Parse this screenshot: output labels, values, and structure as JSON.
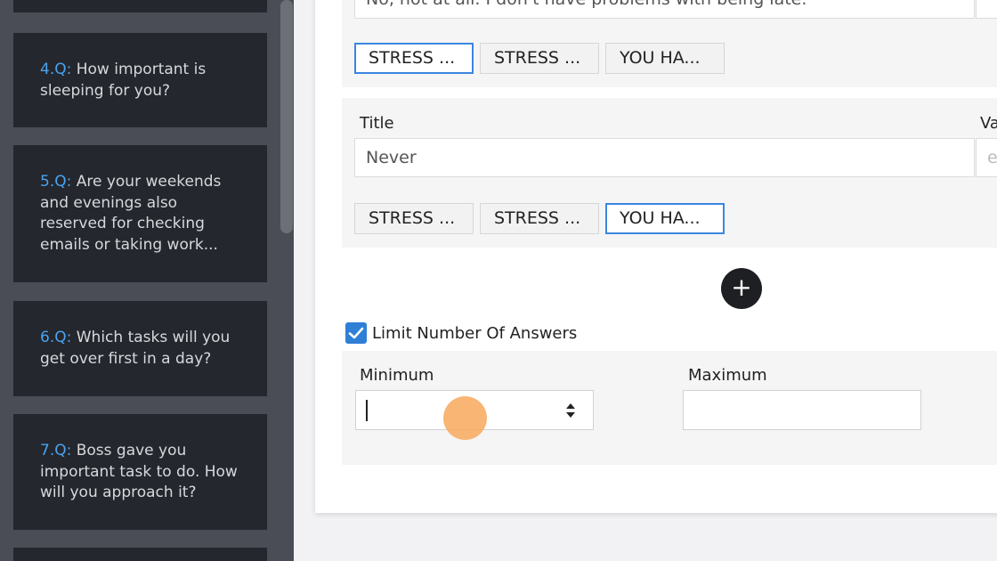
{
  "sidebar": {
    "questions": [
      {
        "num": "4.Q:",
        "lines": [
          "How important is",
          "sleeping for you?"
        ]
      },
      {
        "num": "5.Q:",
        "lines": [
          "Are your weekends",
          "and evenings also",
          "reserved for checking",
          "emails or taking work..."
        ]
      },
      {
        "num": "6.Q:",
        "lines": [
          "Which tasks will you",
          "get over first in a day?"
        ]
      },
      {
        "num": "7.Q:",
        "lines": [
          "Boss gave you",
          "important task to do. How",
          "will you approach it?"
        ]
      }
    ]
  },
  "answers": [
    {
      "title_value": "No, not at all. I don't have problems with being late.",
      "tags": [
        "STRESS ...",
        "STRESS ...",
        "YOU HA..."
      ],
      "selected_tag": 0
    },
    {
      "title_label": "Title",
      "value_label": "Va",
      "title_value": "Never",
      "value_placeholder": "e",
      "tags": [
        "STRESS ...",
        "STRESS ...",
        "YOU HA..."
      ],
      "selected_tag": 2
    }
  ],
  "add_button": {
    "label": "+"
  },
  "limit": {
    "checkbox_label": "Limit Number Of Answers",
    "checked": true,
    "minimum_label": "Minimum",
    "maximum_label": "Maximum",
    "minimum_value": "",
    "maximum_value": ""
  },
  "colors": {
    "accent": "#3a86e0",
    "question_number": "#4aa3f0",
    "sidebar_bg": "#4a4d55",
    "card_bg": "#24272d"
  }
}
